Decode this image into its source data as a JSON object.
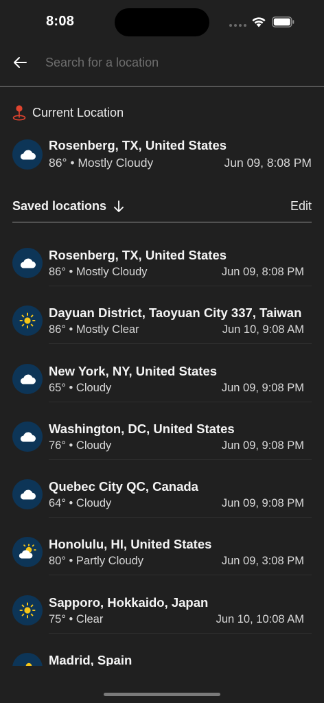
{
  "status_bar": {
    "time": "8:08"
  },
  "search": {
    "placeholder": "Search for a location",
    "value": ""
  },
  "current_location": {
    "label": "Current Location",
    "name": "Rosenberg, TX, United States",
    "temp": "86°",
    "condition": "Mostly Cloudy",
    "datetime": "Jun 09, 8:08 PM",
    "icon": "cloud-icon"
  },
  "saved": {
    "title": "Saved locations",
    "edit_label": "Edit",
    "items": [
      {
        "name": "Rosenberg, TX, United States",
        "temp": "86°",
        "condition": "Mostly Cloudy",
        "datetime": "Jun 09, 8:08 PM",
        "icon": "cloud-icon"
      },
      {
        "name": "Dayuan District, Taoyuan City 337, Taiwan",
        "temp": "86°",
        "condition": "Mostly Clear",
        "datetime": "Jun 10, 9:08 AM",
        "icon": "sun-icon"
      },
      {
        "name": "New York, NY, United States",
        "temp": "65°",
        "condition": "Cloudy",
        "datetime": "Jun 09, 9:08 PM",
        "icon": "cloud-icon"
      },
      {
        "name": "Washington, DC, United States",
        "temp": "76°",
        "condition": "Cloudy",
        "datetime": "Jun 09, 9:08 PM",
        "icon": "cloud-icon"
      },
      {
        "name": "Quebec City QC, Canada",
        "temp": "64°",
        "condition": "Cloudy",
        "datetime": "Jun 09, 9:08 PM",
        "icon": "cloud-icon"
      },
      {
        "name": "Honolulu, HI, United States",
        "temp": "80°",
        "condition": "Partly Cloudy",
        "datetime": "Jun 09, 3:08 PM",
        "icon": "partly-cloudy-icon"
      },
      {
        "name": "Sapporo, Hokkaido, Japan",
        "temp": "75°",
        "condition": "Clear",
        "datetime": "Jun 10, 10:08 AM",
        "icon": "sun-icon"
      },
      {
        "name": "Madrid, Spain",
        "temp": "",
        "condition": "",
        "datetime": "",
        "icon": "partly-cloudy-icon"
      }
    ]
  },
  "colors": {
    "background": "#202020",
    "badge": "#0d3557",
    "sun": "#f5c518",
    "pin": "#e0442f"
  }
}
